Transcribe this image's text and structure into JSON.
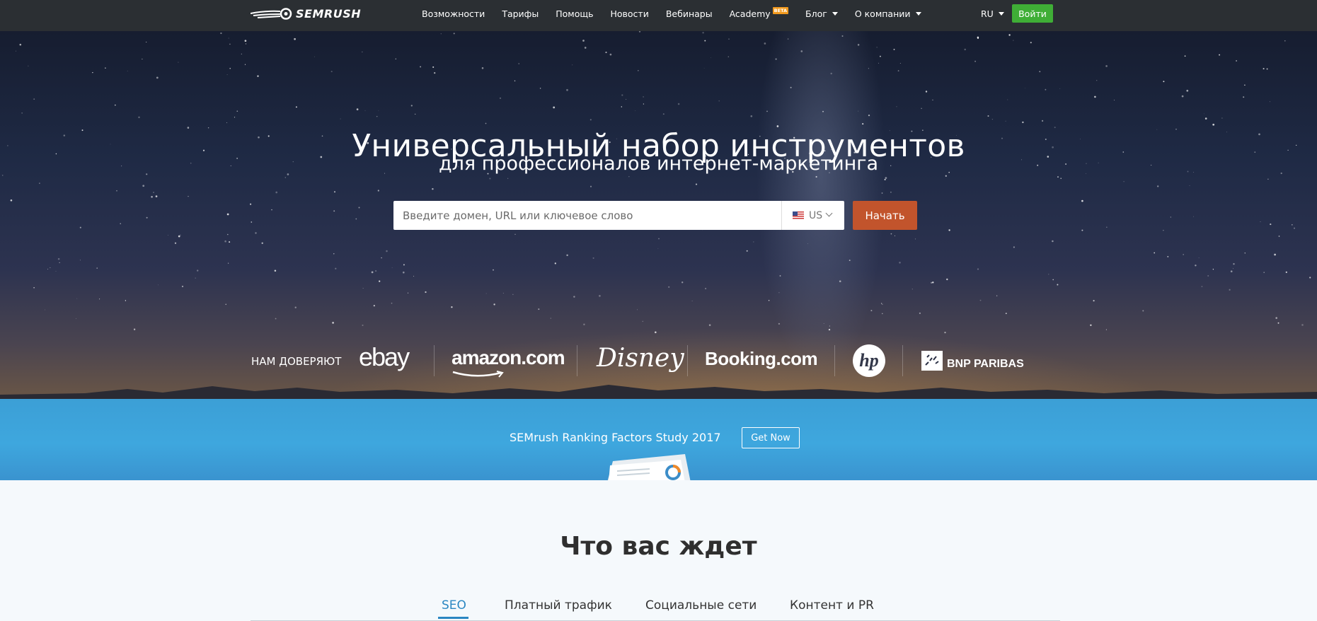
{
  "brand": {
    "logo_text": "SEMRUSH"
  },
  "nav": {
    "items": [
      {
        "label": "Возможности",
        "caret": false
      },
      {
        "label": "Тарифы",
        "caret": false
      },
      {
        "label": "Помощь",
        "caret": false
      },
      {
        "label": "Новости",
        "caret": false
      },
      {
        "label": "Вебинары",
        "caret": false
      },
      {
        "label": "Academy",
        "badge": "BETA",
        "caret": false
      },
      {
        "label": "Блог",
        "caret": true
      },
      {
        "label": "О компании",
        "caret": true
      }
    ],
    "language": "RU",
    "login_label": "Войти"
  },
  "hero": {
    "title": "Универсальный набор инструментов",
    "subtitle": "для профессионалов интернет-маркетинга",
    "search_placeholder": "Введите домен, URL или ключевое слово",
    "country": "US",
    "start_label": "Начать"
  },
  "trust": {
    "label": "НАМ ДОВЕРЯЮТ",
    "brands": [
      "ebay",
      "amazon.com",
      "Disney",
      "Booking.com",
      "hp",
      "BNP PARIBAS"
    ]
  },
  "promo": {
    "text": "SEMrush Ranking Factors Study 2017",
    "button_label": "Get Now"
  },
  "features": {
    "title": "Что вас ждет",
    "tabs": [
      "SEO",
      "Платный трафик",
      "Социальные сети",
      "Контент и PR"
    ],
    "active_tab": "SEO"
  },
  "colors": {
    "topbar": "#2b2f33",
    "login": "#3fae36",
    "start": "#c2542c",
    "promo": "#3ea7de",
    "tab_active": "#2b87c2",
    "beta": "#f29a1e"
  }
}
